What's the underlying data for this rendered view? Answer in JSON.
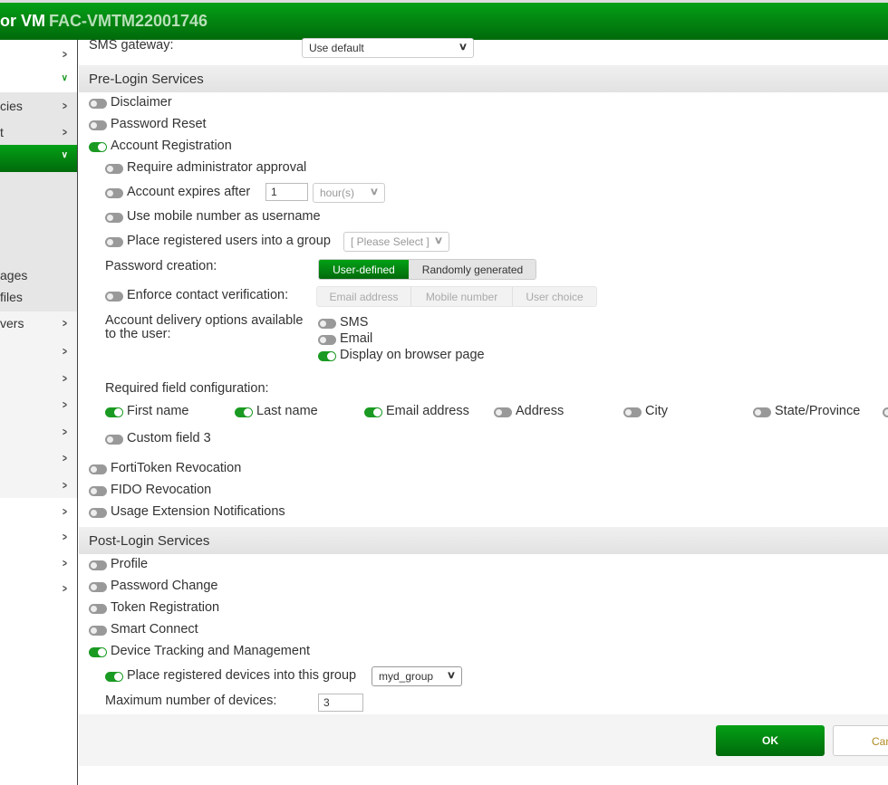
{
  "header": {
    "product": "or VM",
    "serial": "FAC-VMTM22001746"
  },
  "sidebar": {
    "items": [
      {
        "label": "",
        "icon": "chevron-right"
      },
      {
        "label": "",
        "icon": "chevron-down"
      },
      {
        "label": "cies",
        "icon": "chevron-right"
      },
      {
        "label": "t",
        "icon": "chevron-right"
      },
      {
        "label": "",
        "icon": "chevron-down",
        "selected": true
      },
      {
        "label": "ages"
      },
      {
        "label": "files"
      },
      {
        "label": "vers",
        "icon": "chevron-right"
      }
    ]
  },
  "form": {
    "sms_gateway_label": "SMS gateway:",
    "sms_gateway_value": "Use default",
    "pre_login_title": "Pre-Login Services",
    "disclaimer": "Disclaimer",
    "password_reset": "Password Reset",
    "account_registration": "Account Registration",
    "require_admin": "Require administrator approval",
    "account_expires": "Account expires after",
    "expires_value": "1",
    "expires_unit": "hour(s)",
    "use_mobile": "Use mobile number as username",
    "place_group": "Place registered users into a group",
    "group_placeholder": "[ Please Select ]",
    "password_creation": "Password creation:",
    "user_defined": "User-defined",
    "randomly_generated": "Randomly generated",
    "enforce_contact": "Enforce contact verification:",
    "email_address_opt": "Email address",
    "mobile_number_opt": "Mobile number",
    "user_choice_opt": "User choice",
    "delivery_label": "Account delivery options available to the user:",
    "sms": "SMS",
    "email": "Email",
    "display_browser": "Display on browser page",
    "required_fields_label": "Required field configuration:",
    "fields": [
      {
        "label": "First name",
        "on": true
      },
      {
        "label": "Last name",
        "on": true
      },
      {
        "label": "Email address",
        "on": true
      },
      {
        "label": "Address",
        "on": false
      },
      {
        "label": "City",
        "on": false
      },
      {
        "label": "State/Province",
        "on": false
      },
      {
        "label": "Custom field 3",
        "on": false
      }
    ],
    "fortitoken_revocation": "FortiToken Revocation",
    "fido_revocation": "FIDO Revocation",
    "usage_extension": "Usage Extension Notifications",
    "post_login_title": "Post-Login Services",
    "profile": "Profile",
    "password_change": "Password Change",
    "token_registration": "Token Registration",
    "smart_connect": "Smart Connect",
    "device_tracking": "Device Tracking and Management",
    "place_devices": "Place registered devices into this group",
    "device_group": "myd_group",
    "max_devices_label": "Maximum number of devices:",
    "max_devices": "3"
  },
  "footer": {
    "ok": "OK",
    "cancel": "Can"
  }
}
